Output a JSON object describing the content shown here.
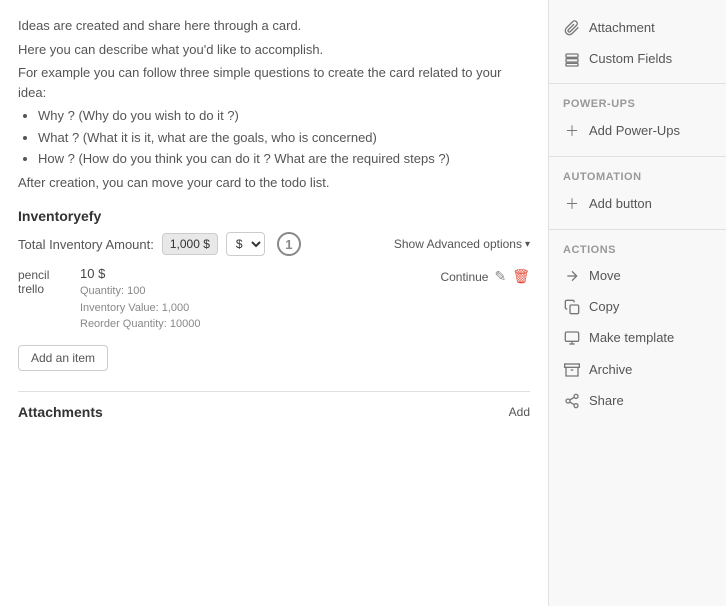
{
  "main": {
    "intro": {
      "line1": "Ideas are created and share here through a card.",
      "line2": "Here you can describe what you'd like to accomplish.",
      "line3": "For example you can follow three simple questions to create the card related to your idea:",
      "bullets": [
        "Why ? (Why do you wish to do it ?)",
        "What ? (What it is it, what are the goals, who is concerned)",
        "How ? (How do you think you can do it ? What are the required steps ?)"
      ],
      "line4": "After creation, you can move your card to the todo list."
    },
    "section_title": "Inventoryefy",
    "inventory": {
      "label": "Total Inventory Amount:",
      "amount": "1,000 $",
      "currency": "$",
      "step": "1",
      "show_advanced": "Show Advanced options",
      "item": {
        "name_line1": "pencil",
        "name_line2": "trello",
        "price": "10 $",
        "quantity": "Quantity: 100",
        "inv_value": "Inventory Value: 1,000",
        "reorder": "Reorder Quantity: 10000",
        "continue_label": "Continue"
      },
      "add_item_label": "Add an item"
    }
  },
  "attachments": {
    "title": "Attachments",
    "add_label": "Add"
  },
  "sidebar": {
    "attachment": {
      "label": "Attachment"
    },
    "custom_fields": {
      "label": "Custom Fields"
    },
    "powerups": {
      "section_title": "Power-Ups",
      "add_label": "Add Power-Ups"
    },
    "automation": {
      "section_title": "Automation",
      "add_label": "Add button"
    },
    "actions": {
      "section_title": "Actions",
      "move": "Move",
      "copy": "Copy",
      "make_template": "Make template",
      "archive": "Archive",
      "share": "Share"
    }
  }
}
